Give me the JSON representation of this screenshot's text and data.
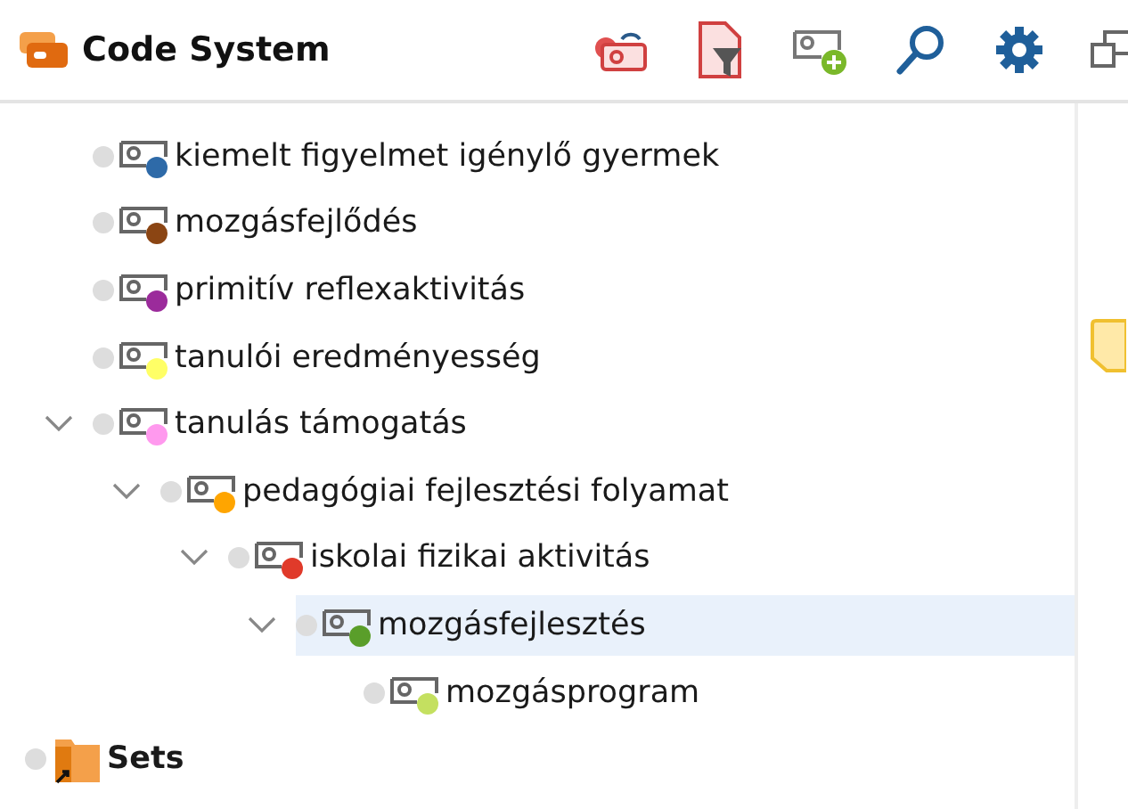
{
  "panel": {
    "title": "Code System"
  },
  "codes": [
    {
      "label": "kiemelt figyelmet igénylő gyermek",
      "color": "#2e6aa8",
      "selected": false
    },
    {
      "label": "mozgásfejlődés",
      "color": "#8b4513",
      "selected": false
    },
    {
      "label": "primitív reflexaktivitás",
      "color": "#9b2b9b",
      "selected": false
    },
    {
      "label": "tanulói eredményesség",
      "color": "#ffff66",
      "selected": false
    },
    {
      "label": "tanulás támogatás",
      "color": "#ff99ee",
      "selected": false,
      "expanded": true,
      "children": [
        {
          "label": "pedagógiai fejlesztési folyamat",
          "color": "#ffa500",
          "selected": false,
          "expanded": true,
          "children": [
            {
              "label": "iskolai fizikai aktivitás",
              "color": "#e03a2a",
              "selected": false,
              "expanded": true,
              "children": [
                {
                  "label": "mozgásfejlesztés",
                  "color": "#5a9e2a",
                  "selected": true,
                  "expanded": true,
                  "children": [
                    {
                      "label": "mozgásprogram",
                      "color": "#c4e060",
                      "selected": false
                    }
                  ]
                }
              ]
            }
          ]
        }
      ]
    }
  ],
  "sets": {
    "label": "Sets"
  }
}
